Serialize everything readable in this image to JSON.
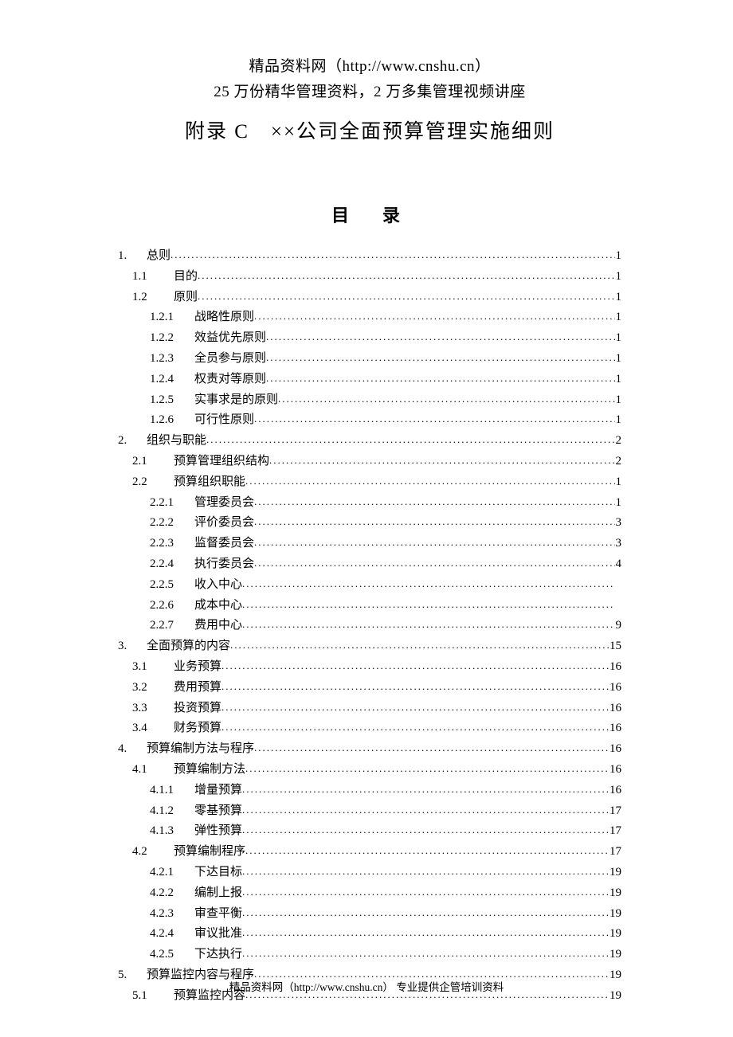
{
  "header": {
    "line1": "精品资料网（http://www.cnshu.cn）",
    "line2": "25 万份精华管理资料，2 万多集管理视频讲座"
  },
  "title": "附录 C　××公司全面预算管理实施细则",
  "toc_heading": "目　录",
  "toc": [
    {
      "level": 1,
      "num": "1.",
      "label": "总则",
      "page": "1"
    },
    {
      "level": 2,
      "num": "1.1",
      "label": "目的",
      "page": "1"
    },
    {
      "level": 2,
      "num": "1.2",
      "label": "原则",
      "page": "1"
    },
    {
      "level": 3,
      "num": "1.2.1",
      "label": "战略性原则",
      "page": "1"
    },
    {
      "level": 3,
      "num": "1.2.2",
      "label": "效益优先原则",
      "page": "1"
    },
    {
      "level": 3,
      "num": "1.2.3",
      "label": "全员参与原则",
      "page": "1"
    },
    {
      "level": 3,
      "num": "1.2.4",
      "label": "权责对等原则",
      "page": "1"
    },
    {
      "level": 3,
      "num": "1.2.5",
      "label": "实事求是的原则",
      "page": "1"
    },
    {
      "level": 3,
      "num": "1.2.6",
      "label": "可行性原则",
      "page": "1"
    },
    {
      "level": 1,
      "num": "2.",
      "label": "组织与职能",
      "page": "2"
    },
    {
      "level": 2,
      "num": "2.1",
      "label": "预算管理组织结构",
      "page": "2"
    },
    {
      "level": 2,
      "num": "2.2",
      "label": "预算组织职能",
      "page": "1"
    },
    {
      "level": 3,
      "num": "2.2.1",
      "label": "管理委员会",
      "page": "1"
    },
    {
      "level": 3,
      "num": "2.2.2",
      "label": "评价委员会",
      "page": "3"
    },
    {
      "level": 3,
      "num": "2.2.3",
      "label": "监督委员会",
      "page": "3"
    },
    {
      "level": 3,
      "num": "2.2.4",
      "label": "执行委员会",
      "page": "4"
    },
    {
      "level": 3,
      "num": "2.2.5",
      "label": "收入中心",
      "page": ""
    },
    {
      "level": 3,
      "num": "2.2.6",
      "label": "成本中心",
      "page": ""
    },
    {
      "level": 3,
      "num": "2.2.7",
      "label": "费用中心",
      "page": "9"
    },
    {
      "level": 1,
      "num": "3.",
      "label": "全面预算的内容",
      "page": "15"
    },
    {
      "level": 2,
      "num": "3.1",
      "label": "业务预算",
      "page": "16"
    },
    {
      "level": 2,
      "num": "3.2",
      "label": "费用预算",
      "page": "16"
    },
    {
      "level": 2,
      "num": "3.3",
      "label": "投资预算",
      "page": "16"
    },
    {
      "level": 2,
      "num": "3.4",
      "label": "财务预算",
      "page": "16"
    },
    {
      "level": 1,
      "num": "4.",
      "label": "预算编制方法与程序",
      "page": "16"
    },
    {
      "level": 2,
      "num": "4.1",
      "label": "预算编制方法",
      "page": "16"
    },
    {
      "level": 3,
      "num": "4.1.1",
      "label": "增量预算",
      "page": "16"
    },
    {
      "level": 3,
      "num": "4.1.2",
      "label": "零基预算",
      "page": "17"
    },
    {
      "level": 3,
      "num": "4.1.3",
      "label": "弹性预算",
      "page": "17"
    },
    {
      "level": 2,
      "num": "4.2",
      "label": "预算编制程序",
      "page": "17"
    },
    {
      "level": 3,
      "num": "4.2.1",
      "label": "下达目标",
      "page": "19"
    },
    {
      "level": 3,
      "num": "4.2.2",
      "label": "编制上报",
      "page": "19"
    },
    {
      "level": 3,
      "num": "4.2.3",
      "label": "审查平衡",
      "page": "19"
    },
    {
      "level": 3,
      "num": "4.2.4",
      "label": "审议批准",
      "page": "19"
    },
    {
      "level": 3,
      "num": "4.2.5",
      "label": "下达执行",
      "page": "19"
    },
    {
      "level": 1,
      "num": "5.",
      "label": "预算监控内容与程序",
      "page": "19"
    },
    {
      "level": 2,
      "num": "5.1",
      "label": "预算监控内容",
      "page": "19"
    }
  ],
  "footer": "精品资料网（http://www.cnshu.cn）  专业提供企管培训资料"
}
